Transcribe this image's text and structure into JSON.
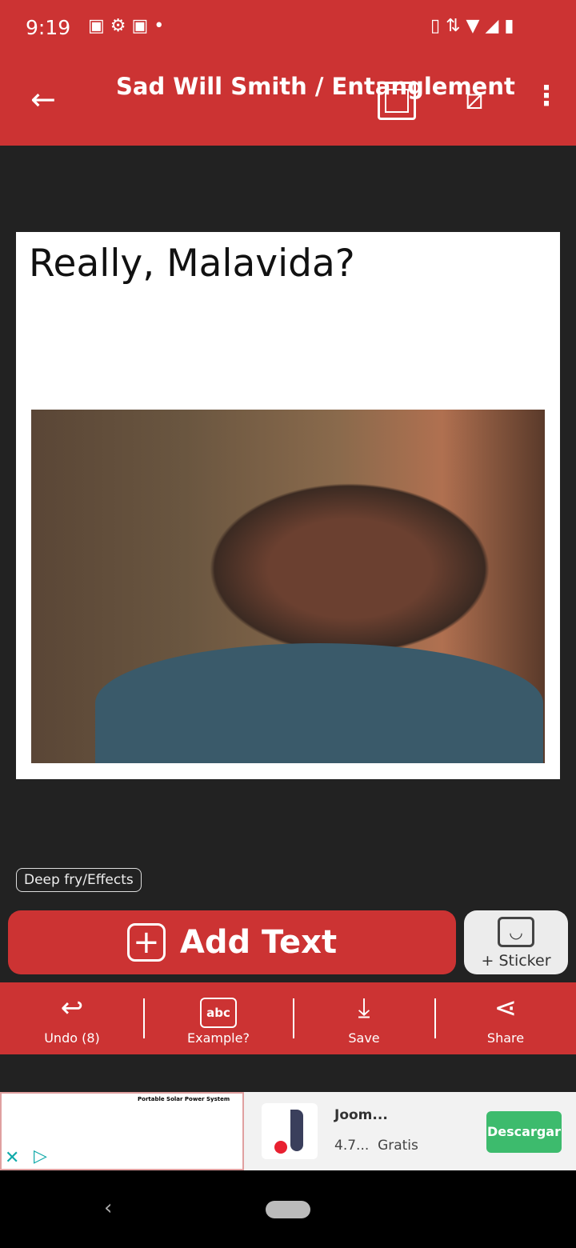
{
  "status": {
    "time": "9:19",
    "icons": [
      "image-icon",
      "gear-icon",
      "image-icon",
      "dot-icon"
    ],
    "right_icons": [
      "vibrate-icon",
      "data-arrows-icon",
      "wifi-icon",
      "signal-icon",
      "battery-icon"
    ]
  },
  "appbar": {
    "title": "Sad Will Smith / Entanglement"
  },
  "meme": {
    "caption": "Really, Malavida?"
  },
  "effects_label": "Deep fry/Effects",
  "add_text_label": "Add Text",
  "sticker_label": "+ Sticker",
  "toolbar": [
    {
      "label": "Undo (8)",
      "icon": "undo-icon"
    },
    {
      "label": "Example?",
      "icon": "speech-bubble-icon"
    },
    {
      "label": "Save",
      "icon": "download-icon"
    },
    {
      "label": "Share",
      "icon": "share-icon"
    }
  ],
  "ad": {
    "image_title": "Portable Solar Power System",
    "app_name": "Joom...",
    "rating": "4.7...",
    "price": "Gratis",
    "cta": "Descargar",
    "cta_color": "#3dbb6d"
  },
  "brand_color": "#cc3333"
}
